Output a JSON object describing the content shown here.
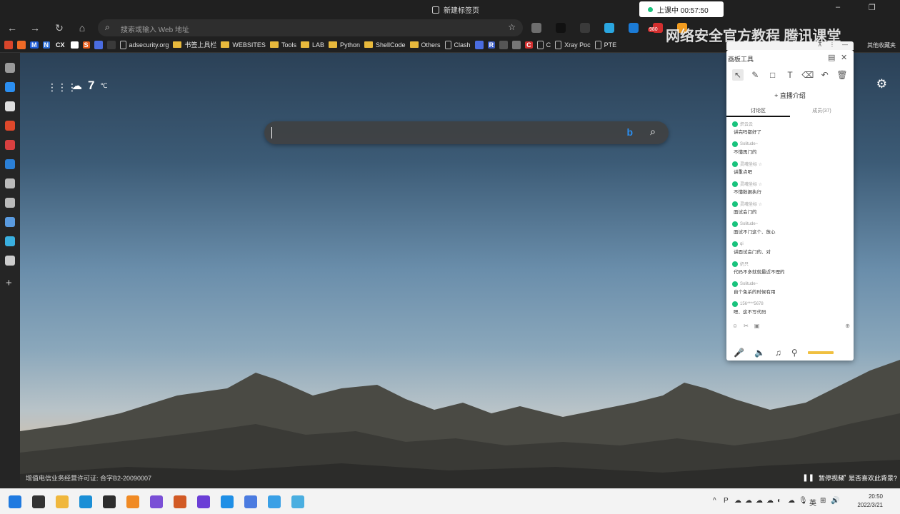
{
  "window": {
    "tab_title": "新建标签页",
    "minimize_glyph": "–",
    "maximize_glyph": "❐",
    "live_status": "上课中 00:57:50"
  },
  "nav": {
    "back_glyph": "←",
    "forward_glyph": "→",
    "refresh_glyph": "↻",
    "home_glyph": "⌂",
    "address_placeholder": "搜索或输入 Web 地址",
    "favorite_glyph": "☆"
  },
  "extensions": [
    {
      "name": "ext-1",
      "color": "#6e6e6e"
    },
    {
      "name": "ext-2",
      "color": "#111111"
    },
    {
      "name": "ext-3",
      "color": "#3a3a3a"
    },
    {
      "name": "ext-4",
      "color": "#2aa6e0"
    },
    {
      "name": "ext-5",
      "color": "#1b7bd6"
    },
    {
      "name": "ext-6",
      "color": "#d32f2f"
    },
    {
      "name": "ext-7",
      "color": "#f29c1f"
    }
  ],
  "ext_badge": "980",
  "bookmarks": [
    {
      "label": "",
      "icon": "red",
      "color": "#d9452b",
      "type": "icon"
    },
    {
      "label": "",
      "icon": "orange",
      "color": "#f06a26",
      "type": "icon"
    },
    {
      "label": "M",
      "color": "#1f5bd6",
      "type": "icon"
    },
    {
      "label": "N",
      "color": "#2d6fd6",
      "type": "icon"
    },
    {
      "label": "CX",
      "color": "#222222",
      "type": "icon"
    },
    {
      "label": "G",
      "color": "#ffffff",
      "type": "icon"
    },
    {
      "label": "S",
      "color": "#e65c1c",
      "type": "icon"
    },
    {
      "label": "",
      "color": "#4a6ce0",
      "type": "icon"
    },
    {
      "label": "",
      "color": "#3a3a3a",
      "type": "icon"
    },
    {
      "label": "adsecurity.org",
      "type": "page"
    },
    {
      "label": "书签上具栏",
      "type": "folder"
    },
    {
      "label": "WEBSITES",
      "type": "folder"
    },
    {
      "label": "Tools",
      "type": "folder"
    },
    {
      "label": "LAB",
      "type": "folder"
    },
    {
      "label": "Python",
      "type": "folder"
    },
    {
      "label": "ShellCode",
      "type": "folder"
    },
    {
      "label": "Others",
      "type": "folder"
    },
    {
      "label": "Clash",
      "type": "page"
    },
    {
      "label": "",
      "color": "#4a6ce0",
      "type": "icon"
    },
    {
      "label": "R",
      "color": "#3b5cc4",
      "type": "icon"
    },
    {
      "label": "",
      "color": "#555555",
      "type": "icon"
    },
    {
      "label": "",
      "color": "#777777",
      "type": "icon"
    },
    {
      "label": "C",
      "color": "#d32f2f",
      "type": "icon"
    },
    {
      "label": "C",
      "type": "page"
    },
    {
      "label": "Xray Poc",
      "type": "page"
    },
    {
      "label": "PTE",
      "type": "page"
    }
  ],
  "bookmarks_overflow": "其他收藏夹",
  "sidebar": [
    {
      "name": "tabs-icon",
      "color": "#9a9a9a"
    },
    {
      "name": "bing-icon",
      "color": "#2b8ef0"
    },
    {
      "name": "github-icon",
      "color": "#e0e0e0"
    },
    {
      "name": "red-app-icon",
      "color": "#e0482b"
    },
    {
      "name": "mail-app-icon",
      "color": "#d94040"
    },
    {
      "name": "translate-icon",
      "color": "#2b7fd6"
    },
    {
      "name": "doc-icon",
      "color": "#bbbbbb"
    },
    {
      "name": "doc-icon-2",
      "color": "#bbbbbb"
    },
    {
      "name": "search-app-icon",
      "color": "#5a9be0"
    },
    {
      "name": "arrow-app-icon",
      "color": "#3ab0e0"
    },
    {
      "name": "panel-icon",
      "color": "#cccccc"
    }
  ],
  "sidebar_add": "+",
  "page": {
    "apps_glyph": "⋮⋮⋮",
    "weather_glyph": "☁",
    "temperature": "7",
    "temp_unit": "℃",
    "settings_glyph": "⚙",
    "search_bing_glyph": "b",
    "search_glyph": "⌕",
    "footer_license": "增值电信业务经营许可证: 合字B2-20090007",
    "pause_label": "暂停视频",
    "pause_glyph": "❚❚",
    "feedback_label": "是否喜欢此背景?",
    "feedback_glyph": "⤢"
  },
  "watermark": "网络安全官方教程 腾讯课堂",
  "whiteboard": {
    "title": "画板工具",
    "tools": [
      {
        "name": "select-tool",
        "glyph": "↖",
        "active": true
      },
      {
        "name": "pen-tool",
        "glyph": "✎",
        "active": false
      },
      {
        "name": "rect-tool",
        "glyph": "□",
        "active": false
      },
      {
        "name": "text-tool",
        "glyph": "T",
        "active": false
      },
      {
        "name": "eraser-tool",
        "glyph": "⌫",
        "active": false
      },
      {
        "name": "undo-tool",
        "glyph": "↶",
        "active": false
      },
      {
        "name": "delete-tool",
        "glyph": "🗑",
        "active": false
      }
    ],
    "intro_label": "+ 直播介绍",
    "tabs": [
      {
        "label": "讨论区",
        "active": true
      },
      {
        "label": "成员(37)",
        "active": false
      }
    ],
    "messages": [
      {
        "user": "炽云云",
        "text": "讲完吗都好了"
      },
      {
        "user": "Solitude~",
        "text": "不懂再门的"
      },
      {
        "user": "灵魂坐标 ☆",
        "text": "讲重点吧"
      },
      {
        "user": "灵魂坐标 ☆",
        "text": "不懂数据执行"
      },
      {
        "user": "灵魂坐标 ☆",
        "text": "面试会门的"
      },
      {
        "user": "Solitude~",
        "text": "面试不门这个、放心"
      },
      {
        "user": "qi",
        "text": "讲面试会门的、对"
      },
      {
        "user": "奶只",
        "text": "代码不多就就最近不理的"
      },
      {
        "user": "Solitude~",
        "text": "自个免杀的时候有用"
      },
      {
        "user": "156****5678",
        "text": "嗯、这不写代码"
      }
    ],
    "bottom_icons": [
      "☺",
      "✂",
      "▣"
    ],
    "bottom_right": "⊕",
    "media": {
      "mic": "🎤",
      "speaker": "🔈",
      "music": "♫",
      "pin": "⚲"
    }
  },
  "taskbar": {
    "apps": [
      {
        "name": "start-icon",
        "color": "#1f7ae0"
      },
      {
        "name": "terminal-app-icon",
        "color": "#333333"
      },
      {
        "name": "file-explorer-icon",
        "color": "#f0b73c"
      },
      {
        "name": "edge-icon",
        "color": "#1b8fd6"
      },
      {
        "name": "terminal-icon",
        "color": "#2d2d2d"
      },
      {
        "name": "sublime-icon",
        "color": "#f08a24"
      },
      {
        "name": "obsidian-icon",
        "color": "#7a4fd6"
      },
      {
        "name": "burp-icon",
        "color": "#d25a25"
      },
      {
        "name": "lightning-app-icon",
        "color": "#6b3fd6"
      },
      {
        "name": "pycharm-icon",
        "color": "#1f8fe6"
      },
      {
        "name": "chrome-icon",
        "color": "#4b7be0"
      },
      {
        "name": "feishu-icon",
        "color": "#3aa0e6"
      },
      {
        "name": "qq-icon",
        "color": "#4aaee0"
      }
    ],
    "tray": [
      "^",
      "P",
      "☁",
      "☁",
      "☁",
      "☁",
      "◐",
      "☁",
      "🎙",
      "英",
      "⊞",
      "🔊"
    ],
    "time": "20:50",
    "date": "2022/3/21"
  }
}
